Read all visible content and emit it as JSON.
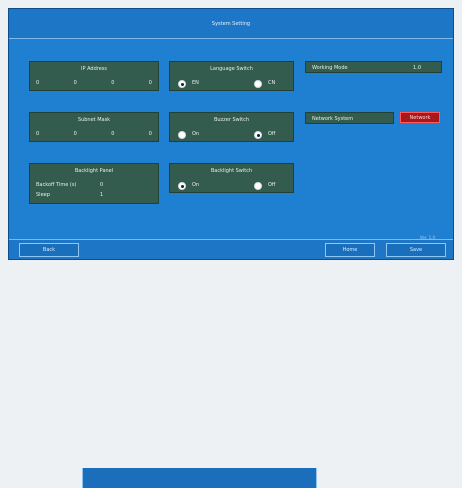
{
  "app": {
    "title": "System Setting"
  },
  "panels": {
    "ip_address": {
      "label": "IP Address",
      "values": [
        "0",
        "0",
        "0",
        "0"
      ]
    },
    "subnet_mask": {
      "label": "Subnet Mask",
      "values": [
        "0",
        "0",
        "0",
        "0"
      ]
    },
    "language_switch": {
      "label": "Language Switch",
      "options": [
        "EN",
        "CN"
      ]
    },
    "buzzer_switch": {
      "label": "Buzzer Switch",
      "options": [
        "On",
        "Off"
      ]
    },
    "backlight_switch": {
      "label": "Backlight Switch",
      "options": [
        "On",
        "Off"
      ]
    },
    "backlight_panel": {
      "label": "Backlight Panel",
      "fields": [
        {
          "label": "Backoff Time (s)",
          "value": "0"
        },
        {
          "label": "Sleep",
          "value": "1"
        }
      ]
    },
    "working_mode": {
      "label": "Working Mode",
      "value": "1.0"
    },
    "network_system": {
      "label": "Network System",
      "value": "Network"
    }
  },
  "footer": {
    "left_button": "Back",
    "middle_button": "Home",
    "right_button": "Save",
    "version": "Ver. 1.0"
  },
  "colors": {
    "background": "#1f7fd1",
    "panel": "#335c4f",
    "alarm": "#a8171c"
  }
}
